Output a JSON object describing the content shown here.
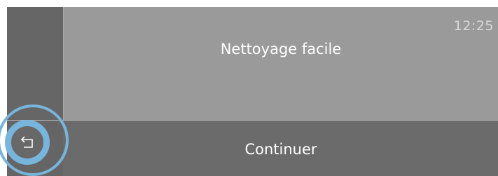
{
  "header": {
    "clock": "12:25",
    "title": "Nettoyage facile"
  },
  "footer": {
    "continue_label": "Continuer",
    "back_icon": "back-arrow-icon"
  },
  "colors": {
    "accent": "#78b5dc",
    "main_panel": "#9a9a9a",
    "side_panel": "#666666",
    "bottom_bar": "#6b6b6b",
    "text": "#ffffff"
  }
}
